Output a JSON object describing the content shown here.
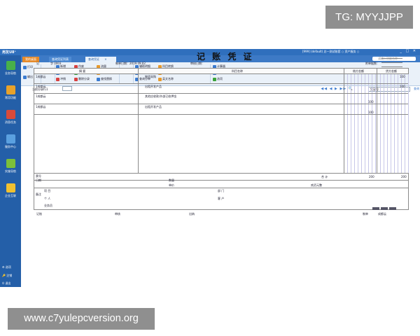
{
  "watermark_top": "TG: MYYJJPP",
  "watermark_bottom": "www.c7yulepcversion.org",
  "app": {
    "logo": "用友U8⁺",
    "sysinfo": "[999] (default) 总一测试账套  ○ 资产服务  ○",
    "window_controls": "_ □ ✕"
  },
  "sidebar": {
    "items": [
      "业务导航",
      "常用功能",
      "消息任务",
      "服务中心",
      "实施导航",
      "企业互联"
    ],
    "bottom": [
      "选项",
      "注销",
      "退出"
    ]
  },
  "tabs": {
    "home": "我的桌面",
    "list": "查询凭证列表",
    "active": "查询凭证",
    "close": "×"
  },
  "search": {
    "placeholder": "请输入功能名称"
  },
  "toolbar": {
    "print": "打印",
    "output": "输出",
    "modify": "修改",
    "add": "新增",
    "copy": "复制",
    "red": "冲销",
    "void": "作废",
    "insert": "插入分录",
    "delete": "删除分录",
    "flow": "流量",
    "balance": "备查",
    "query_replace": "查找替换",
    "save": "保存",
    "aux": "辅助明细",
    "contact": "联查",
    "query_entry": "查询分单",
    "subject_convert": "科目转换",
    "balance2": "余额",
    "text_label": "英文名称",
    "show_all": "显示空凭证号",
    "calc": "计算器",
    "accounting_date": "会计日历",
    "options": "选项"
  },
  "subbar": {
    "page_label": "当前分录行1",
    "voucher_placeholder": "凭证号",
    "query": "查询",
    "nav": "◀◀ ◀ ▶ ▶▶ 🔍"
  },
  "voucher": {
    "title": "记 账 凭 证",
    "type_label": "记",
    "number_label": "字 0003",
    "date_label": "制单日期：2019.09.02",
    "audit_label": "审核日期：",
    "attach_label": "附单据数：",
    "headers": {
      "summary": "摘 要",
      "subject": "科目名称",
      "debit": "借方金额",
      "credit": "贷方金额"
    },
    "rows": [
      {
        "summary": "1成都云",
        "subject": "物资采购",
        "debit": "",
        "credit": "100"
      },
      {
        "summary": "1成都云",
        "subject": "出租开发产品",
        "debit": "",
        "credit": "100"
      },
      {
        "summary": "1成都云",
        "subject": "其他应收款/外部已收押金",
        "debit": "100",
        "credit": ""
      },
      {
        "summary": "1成都云",
        "subject": "出租开发产品",
        "debit": "100",
        "credit": ""
      }
    ],
    "total_label": "合 计",
    "total_debit": "200",
    "total_credit": "200",
    "total_words": "贰佰元整",
    "foot": {
      "ticket": "票号",
      "date": "日期",
      "qty": "数量",
      "price": "单价",
      "note": "备注",
      "project": "项 目",
      "person": "个 人",
      "sales": "业务员",
      "dept": "部 门",
      "customer": "客 户"
    },
    "signatures": {
      "bookkeeping": "记账",
      "audit": "审核",
      "cashier": "出纳",
      "maker": "制单",
      "maker_name": "成都云"
    }
  }
}
